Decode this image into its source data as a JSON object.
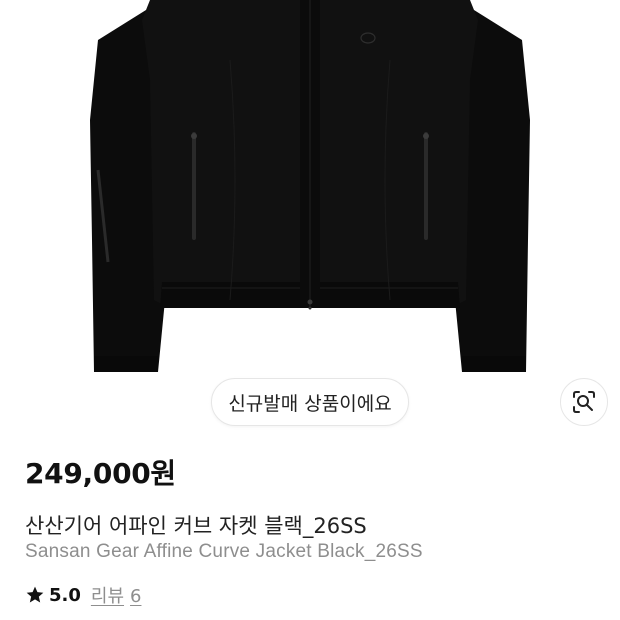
{
  "product": {
    "image_alt": "black jacket product photo",
    "new_badge": "신규발매 상품이에요",
    "lens_icon": "image-search-icon",
    "price": "249,000원",
    "name_ko": "산산기어 어파인 커브 자켓 블랙_26SS",
    "name_en": "Sansan Gear Affine Curve Jacket Black_26SS",
    "rating": {
      "star_icon": "star-icon",
      "value": "5.0",
      "review_label": "리뷰",
      "review_count": "6"
    }
  },
  "colors": {
    "jacket": "#0d0d0d",
    "text_primary": "#111111",
    "text_secondary": "#8e8e8e",
    "border": "#e6e6e6"
  }
}
